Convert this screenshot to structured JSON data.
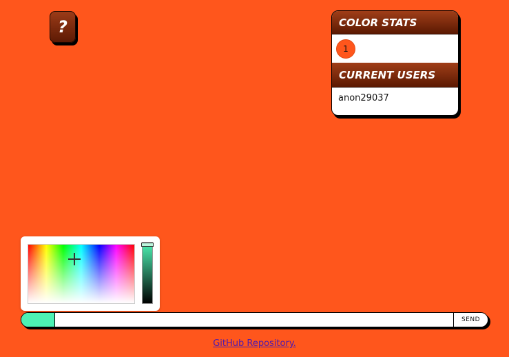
{
  "help_button": {
    "label": "?"
  },
  "stats_panel": {
    "color_stats_title": "COLOR STATS",
    "color_count": "1",
    "color_count_color": "#ff561c",
    "current_users_title": "CURRENT USERS",
    "users": [
      "anon29037"
    ]
  },
  "color_picker": {
    "selected_color": "#4df2b4"
  },
  "chat": {
    "input_value": "",
    "send_label": "SEND"
  },
  "footer": {
    "github_link": "GitHub Repository."
  },
  "colors": {
    "background": "#ff561c",
    "accent": "#4df2b4",
    "header": "#7a2608"
  }
}
